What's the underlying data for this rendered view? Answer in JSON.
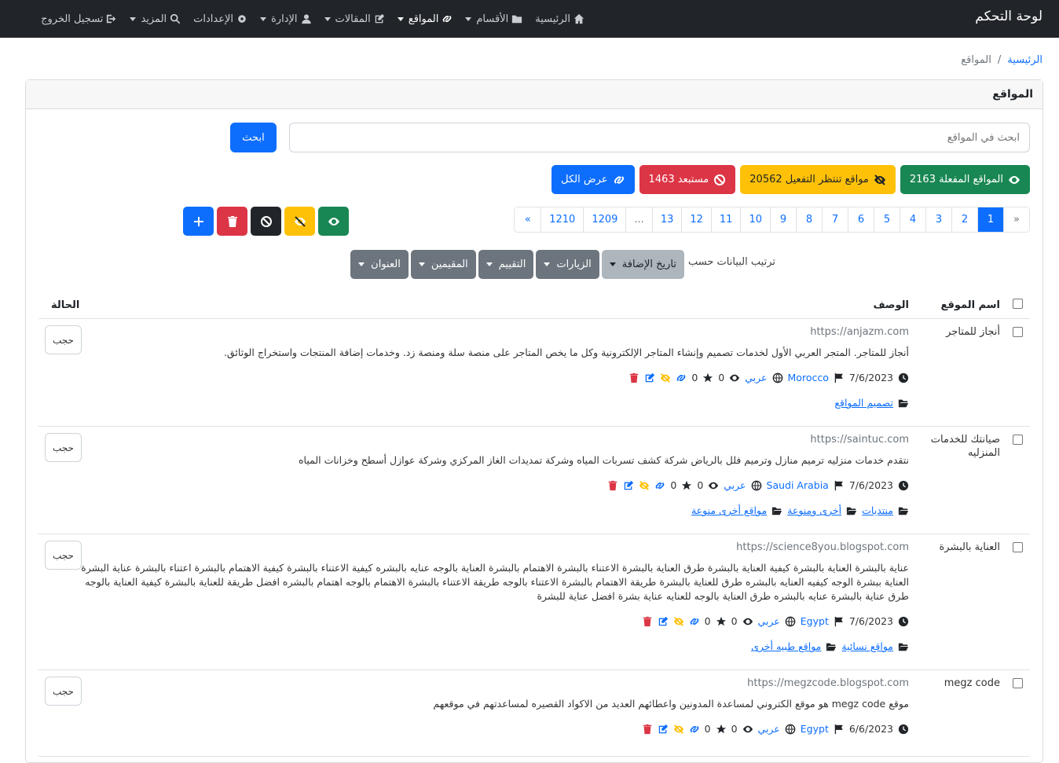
{
  "nav": {
    "brand": "لوحة التحكم",
    "items": [
      {
        "label": "الرئيسية",
        "icon": "home-icon"
      },
      {
        "label": "الأقسام",
        "icon": "folder-icon"
      },
      {
        "label": "المواقع",
        "icon": "link-icon"
      },
      {
        "label": "المقالات",
        "icon": "edit-icon"
      },
      {
        "label": "الإدارة",
        "icon": "user-icon"
      },
      {
        "label": "الإعدادات",
        "icon": "gear-icon"
      },
      {
        "label": "المزيد",
        "icon": "search-icon"
      },
      {
        "label": "تسجيل الخروج",
        "icon": "logout-icon"
      }
    ]
  },
  "breadcrumb": {
    "home": "الرئيسية",
    "sep": "/",
    "current": "المواقع"
  },
  "card": {
    "title": "المواقع"
  },
  "search": {
    "placeholder": "ابحث في المواقع",
    "button": "ابحث"
  },
  "filters": {
    "active": "المواقع المفعلة 2163",
    "pending": "مواقع تنتظر التفعيل 20562",
    "excluded": "مستبعد 1463",
    "all": "عرض الكل"
  },
  "pagination": [
    "«",
    "1",
    "2",
    "3",
    "4",
    "5",
    "6",
    "7",
    "8",
    "9",
    "10",
    "11",
    "12",
    "13",
    "...",
    "1209",
    "1210",
    "»"
  ],
  "sort": {
    "label": "ترتيب البيانات حسب",
    "buttons": [
      "تاريخ الإضافة",
      "الزيارات",
      "التقييم",
      "المقيمين",
      "العنوان"
    ]
  },
  "table": {
    "col_name": "اسم الموقع",
    "col_desc": "الوصف",
    "col_status": "الحالة"
  },
  "rows": [
    {
      "name": "أنجاز للمتاجر",
      "url": "https://anjazm.com",
      "desc": "أنجاز للمتاجر. المتجر العربي الأول لخدمات تصميم وإنشاء المتاجر الإلكترونية وكل ما يخص المتاجر على منصة سلة ومنصة زد. وخدمات إضافة المنتجات واستخراج الوثائق.",
      "date": "7/6/2023",
      "country": "Morocco",
      "lang": "عربي",
      "views": "0",
      "rating": "0",
      "cats": [
        "تصميم المواقع"
      ],
      "status": "حجب"
    },
    {
      "name": "صيانتك للخدمات المنزليه",
      "url": "https://saintuc.com",
      "desc": "نتقدم خدمات منزليه ترميم منازل وترميم فلل بالرياض شركة كشف تسربات المياه وشركة تمديدات الغاز المركزي وشركة عوازل أسطح وخزانات المياه",
      "date": "7/6/2023",
      "country": "Saudi Arabia",
      "lang": "عربي",
      "views": "0",
      "rating": "0",
      "cats": [
        "منتديات",
        "أخرى ومنوعة",
        "مواقع أخرى منوعة"
      ],
      "status": "حجب"
    },
    {
      "name": "العناية بالبشرة",
      "url": "https://science8you.blogspot.com",
      "desc": "عناية بالبشرة العناية بالبشرة كيفية العناية بالبشرة طرق العناية بالبشرة الاعتناء بالبشرة الاهتمام بالبشرة العناية بالوجه عنايه بالبشره كيفية الاعتناء بالبشرة كيفية الاهتمام بالبشرة اعتناء بالبشرة عناية البشرة العناية ببشرة الوجه كيفيه العنايه بالبشره طرق للعناية بالبشرة طريقة الاهتمام بالبشرة الاعتناء بالوجه طريقة الاعتناء بالبشرة الاهتمام بالوجه اهتمام بالبشره افضل طريقة للعناية بالبشرة كيفية العناية بالوجه طرق عناية بالبشرة عنايه بالبشره طرق العناية بالوجه للعنايه عناية بشرة افضل عناية للبشرة",
      "date": "7/6/2023",
      "country": "Egypt",
      "lang": "عربي",
      "views": "0",
      "rating": "0",
      "cats": [
        "مواقع نسائية",
        "مواقع طبيه أخرى"
      ],
      "status": "حجب"
    },
    {
      "name": "megz code",
      "url": "https://megzcode.blogspot.com",
      "desc": "موقع megz code هو موقع الكتروني لمساعدة المدونين واعطائهم العديد من الاكواد القصيره لمساعدتهم في موقعهم",
      "date": "6/6/2023",
      "country": "Egypt",
      "lang": "عربي",
      "views": "0",
      "rating": "0",
      "cats": [],
      "status": "حجب"
    }
  ]
}
